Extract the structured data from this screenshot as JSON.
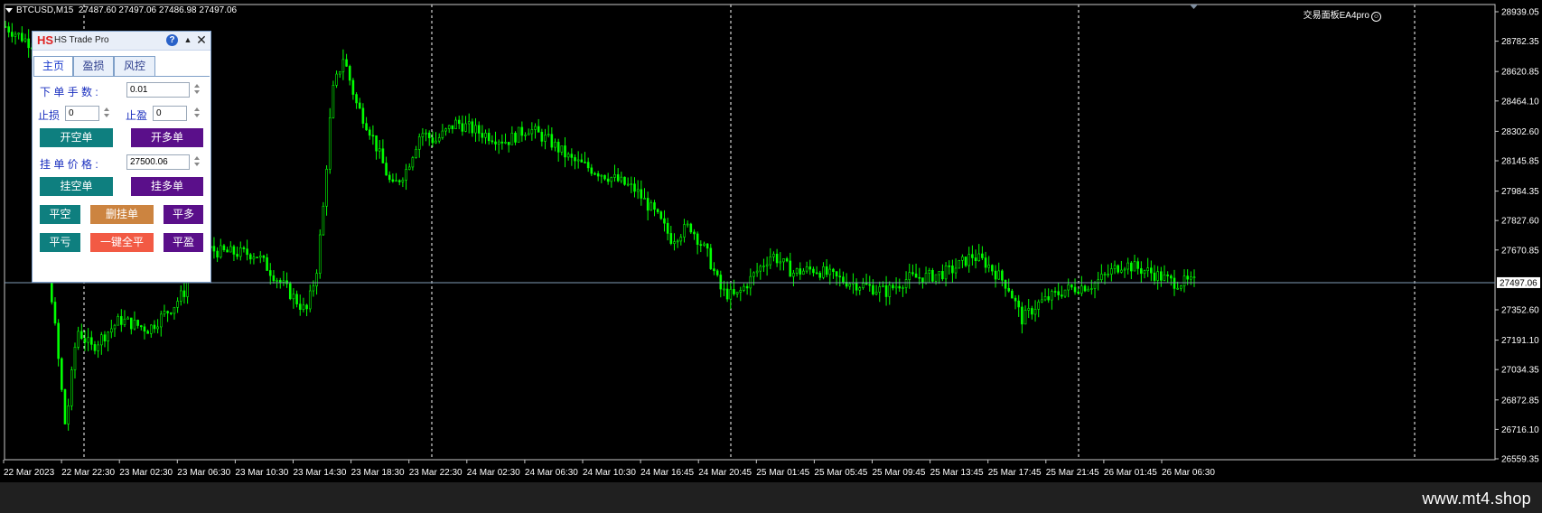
{
  "chart": {
    "symbol_timeframe": "BTCUSD,M15",
    "ohlc": "27487.60 27497.06 27486.98 27497.06",
    "ea_label": "交易面板EA4pro",
    "current_price": "27497.06",
    "colors": {
      "background": "#000000",
      "candles": "#00ff00",
      "current_price_line": "#7f9bb6",
      "period_separator": "#ffffff"
    },
    "price_axis_labels": [
      "28939.05",
      "28782.35",
      "28620.85",
      "28464.10",
      "28302.60",
      "28145.85",
      "27984.35",
      "27827.60",
      "27670.85",
      "27352.60",
      "27191.10",
      "27034.35",
      "26872.85",
      "26716.10",
      "26559.35"
    ],
    "time_axis_labels": [
      "22 Mar 2023",
      "22 Mar 22:30",
      "23 Mar 02:30",
      "23 Mar 06:30",
      "23 Mar 10:30",
      "23 Mar 14:30",
      "23 Mar 18:30",
      "23 Mar 22:30",
      "24 Mar 02:30",
      "24 Mar 06:30",
      "24 Mar 10:30",
      "24 Mar 16:45",
      "24 Mar 20:45",
      "25 Mar 01:45",
      "25 Mar 05:45",
      "25 Mar 09:45",
      "25 Mar 13:45",
      "25 Mar 17:45",
      "25 Mar 21:45",
      "26 Mar 01:45",
      "26 Mar 06:30"
    ],
    "price_path": [
      [
        0,
        28860
      ],
      [
        0.02,
        28760
      ],
      [
        0.025,
        28300
      ],
      [
        0.032,
        27450
      ],
      [
        0.042,
        26720
      ],
      [
        0.05,
        27250
      ],
      [
        0.06,
        27150
      ],
      [
        0.08,
        27300
      ],
      [
        0.1,
        27250
      ],
      [
        0.118,
        27380
      ],
      [
        0.125,
        27450
      ],
      [
        0.13,
        27700
      ],
      [
        0.15,
        27660
      ],
      [
        0.175,
        27650
      ],
      [
        0.185,
        27560
      ],
      [
        0.2,
        27430
      ],
      [
        0.21,
        27340
      ],
      [
        0.217,
        27550
      ],
      [
        0.222,
        27900
      ],
      [
        0.228,
        28500
      ],
      [
        0.236,
        28700
      ],
      [
        0.245,
        28450
      ],
      [
        0.255,
        28300
      ],
      [
        0.27,
        28000
      ],
      [
        0.28,
        28100
      ],
      [
        0.29,
        28300
      ],
      [
        0.3,
        28250
      ],
      [
        0.315,
        28350
      ],
      [
        0.33,
        28300
      ],
      [
        0.35,
        28250
      ],
      [
        0.365,
        28320
      ],
      [
        0.38,
        28250
      ],
      [
        0.395,
        28150
      ],
      [
        0.41,
        28100
      ],
      [
        0.425,
        28050
      ],
      [
        0.44,
        27990
      ],
      [
        0.455,
        27850
      ],
      [
        0.465,
        27730
      ],
      [
        0.478,
        27800
      ],
      [
        0.49,
        27650
      ],
      [
        0.5,
        27450
      ],
      [
        0.51,
        27420
      ],
      [
        0.525,
        27560
      ],
      [
        0.535,
        27650
      ],
      [
        0.55,
        27550
      ],
      [
        0.565,
        27570
      ],
      [
        0.58,
        27520
      ],
      [
        0.6,
        27480
      ],
      [
        0.615,
        27450
      ],
      [
        0.63,
        27520
      ],
      [
        0.645,
        27530
      ],
      [
        0.66,
        27560
      ],
      [
        0.675,
        27640
      ],
      [
        0.685,
        27600
      ],
      [
        0.7,
        27480
      ],
      [
        0.71,
        27300
      ],
      [
        0.72,
        27380
      ],
      [
        0.74,
        27460
      ],
      [
        0.76,
        27490
      ],
      [
        0.78,
        27600
      ],
      [
        0.8,
        27550
      ],
      [
        0.815,
        27500
      ],
      [
        0.83,
        27497
      ]
    ]
  },
  "panel": {
    "logo": "HS",
    "title": "HS Trade Pro",
    "help": "?",
    "collapse": "▲",
    "close": "✕",
    "tabs": [
      "主页",
      "盈损",
      "风控"
    ],
    "lot_label": "下 单 手 数 :",
    "lot_value": "0.01",
    "sl_label": "止损",
    "sl_value": "0",
    "tp_label": "止盈",
    "tp_value": "0",
    "open_sell": "开空单",
    "open_buy": "开多单",
    "pending_price_label": "挂 单 价 格 :",
    "pending_price_value": "27500.06",
    "pending_sell": "挂空单",
    "pending_buy": "挂多单",
    "close_sell": "平空",
    "delete_pending": "删挂单",
    "close_buy": "平多",
    "close_loss": "平亏",
    "close_all": "一键全平",
    "close_profit": "平盈"
  },
  "footer": {
    "watermark": "www.mt4.shop"
  }
}
